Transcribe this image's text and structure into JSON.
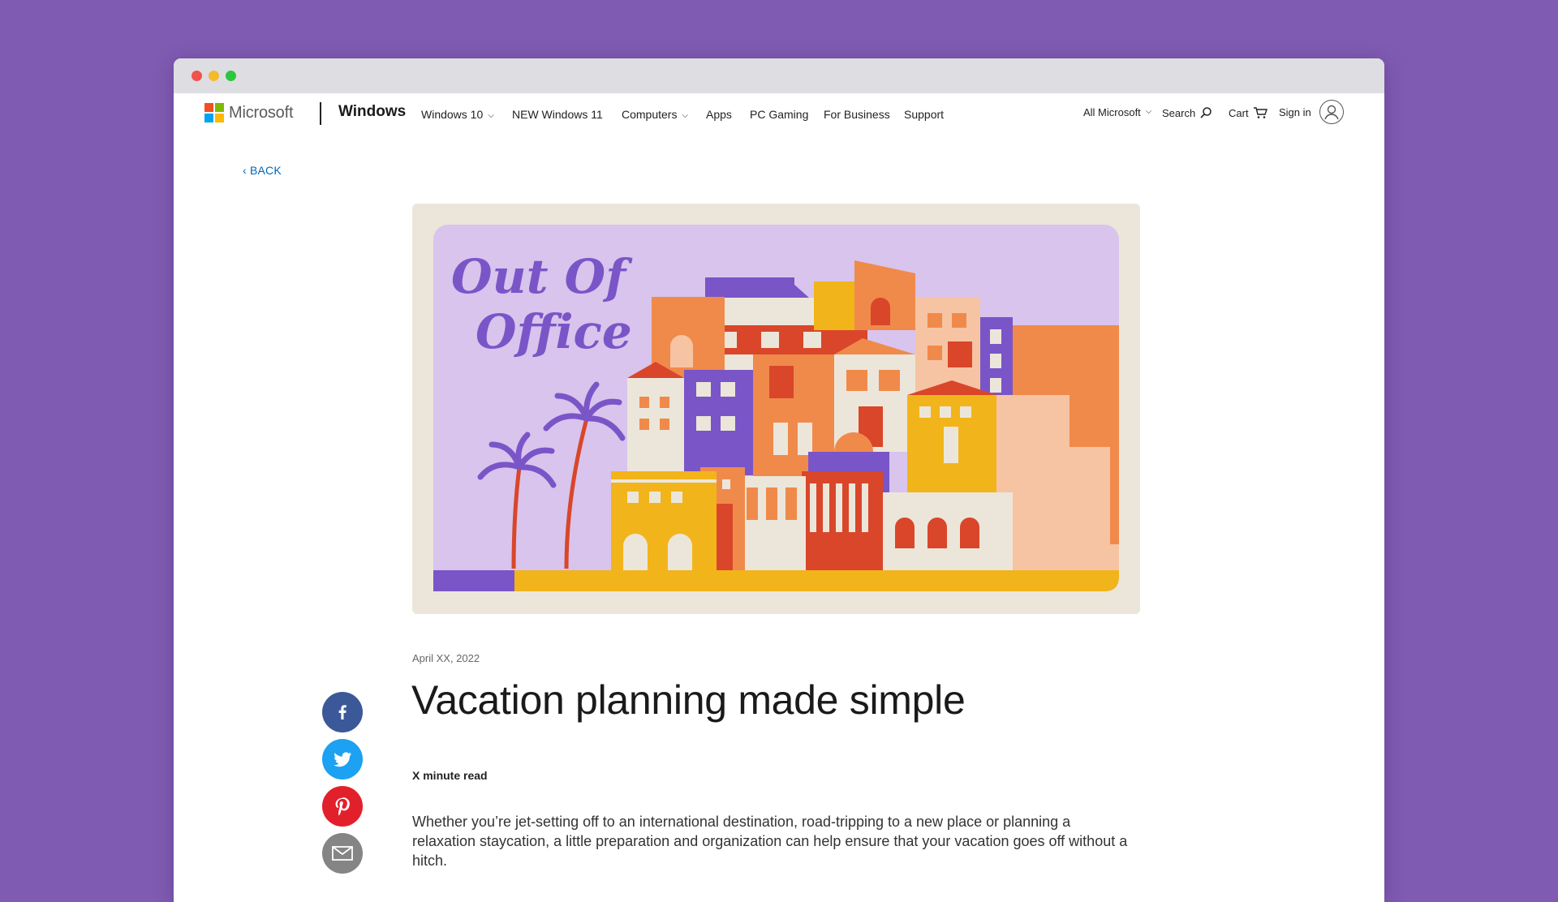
{
  "window": {
    "controls": [
      "close",
      "minimize",
      "maximize"
    ]
  },
  "nav": {
    "brand": "Microsoft",
    "product": "Windows",
    "items": [
      {
        "label": "Windows 10",
        "has_dropdown": true
      },
      {
        "label": "NEW Windows 11",
        "has_dropdown": false
      },
      {
        "label": "Computers",
        "has_dropdown": true
      },
      {
        "label": "Apps",
        "has_dropdown": false
      },
      {
        "label": "PC Gaming",
        "has_dropdown": false
      },
      {
        "label": "For Business",
        "has_dropdown": false
      },
      {
        "label": "Support",
        "has_dropdown": false
      }
    ],
    "all_microsoft": "All Microsoft",
    "search": "Search",
    "cart": "Cart",
    "sign_in": "Sign in"
  },
  "back": {
    "label": "‹ BACK"
  },
  "hero": {
    "text_line1": "Out Of",
    "text_line2": "Office",
    "colors": {
      "background": "#D8C4EC",
      "orange": "#F08A4B",
      "purple": "#7A55C8",
      "red": "#D9462A",
      "yellow": "#F2B41B"
    }
  },
  "article": {
    "date": "April XX, 2022",
    "title": "Vacation planning made simple",
    "read_time": "X minute read",
    "intro": "Whether you’re jet-setting off to an international destination, road-tripping to a new place or planning a relaxation staycation, a little preparation and organization can help ensure that your vacation goes off without a hitch."
  },
  "share": [
    {
      "network": "facebook",
      "icon": "facebook-icon"
    },
    {
      "network": "twitter",
      "icon": "twitter-icon"
    },
    {
      "network": "pinterest",
      "icon": "pinterest-icon"
    },
    {
      "network": "email",
      "icon": "email-icon"
    }
  ]
}
